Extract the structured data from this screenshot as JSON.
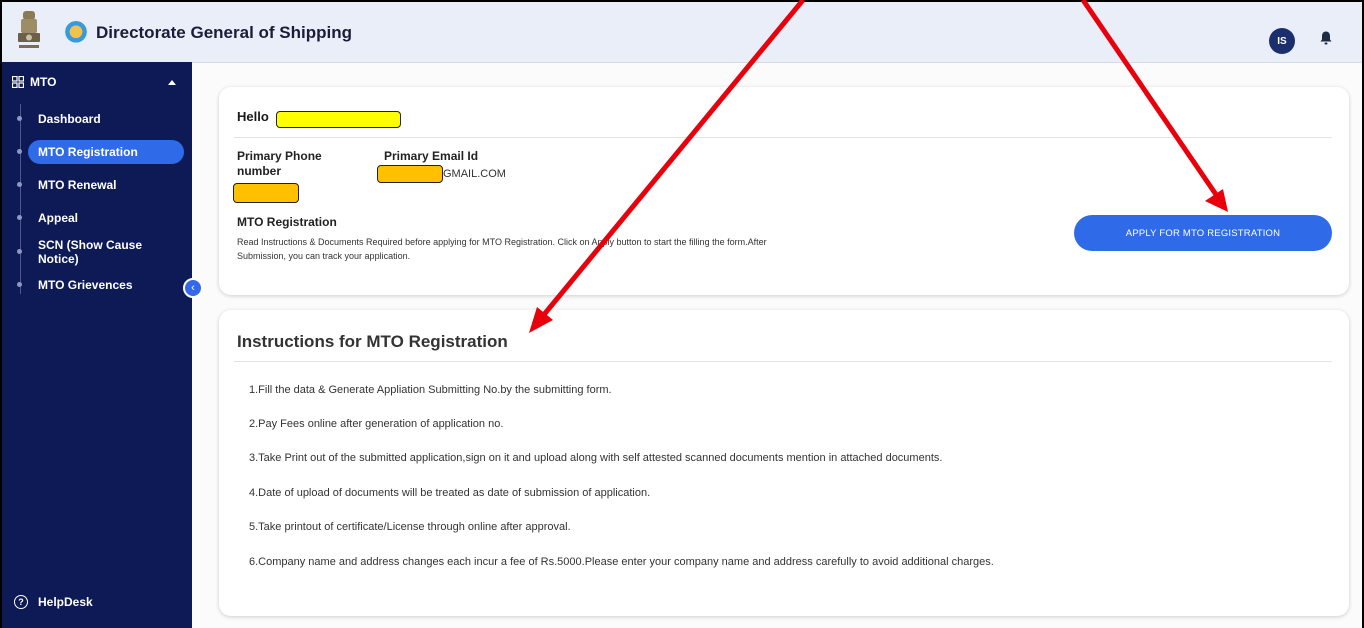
{
  "header": {
    "title": "Directorate General of Shipping",
    "avatar_initials": "IS",
    "icons": [
      "national-emblem-icon",
      "dgs-logo-icon",
      "bell-icon"
    ]
  },
  "sidebar": {
    "group_label": "MTO",
    "items": [
      {
        "label": "Dashboard",
        "active": false
      },
      {
        "label": "MTO Registration",
        "active": true
      },
      {
        "label": "MTO Renewal",
        "active": false
      },
      {
        "label": "Appeal",
        "active": false
      },
      {
        "label": "SCN (Show Cause Notice)",
        "active": false
      },
      {
        "label": "MTO Grievences",
        "active": false
      }
    ],
    "helpdesk_label": "HelpDesk"
  },
  "profile": {
    "greeting": "Hello",
    "phone_label_line1": "Primary Phone",
    "phone_label_line2": "number",
    "email_label": "Primary Email Id",
    "email_suffix": "GMAIL.COM",
    "section_title": "MTO Registration",
    "section_desc": "Read Instructions & Documents Required before applying for MTO Registration. Click on Apply button to start the filling the form.After Submission, you can track your application.",
    "apply_button": "APPLY FOR MTO REGISTRATION"
  },
  "instructions": {
    "title": "Instructions for MTO Registration",
    "lines": [
      "1.Fill the data & Generate Appliation Submitting No.by the submitting form.",
      "2.Pay Fees online after generation of application no.",
      "3.Take Print out of the submitted application,sign on it and upload along with self attested scanned documents mention in attached documents.",
      "4.Date of upload of documents will be treated as date of submission of application.",
      "5.Take printout of certificate/License through online after approval.",
      "6.Company name and address changes each incur a fee of Rs.5000.Please enter your company name and address carefully to avoid additional charges."
    ]
  },
  "colors": {
    "sidebar_bg": "#0d1a56",
    "accent": "#2f6be8",
    "annotation_arrow": "#e8000b",
    "redaction_yellow": "#ffff00",
    "redaction_orange": "#ffc000"
  }
}
